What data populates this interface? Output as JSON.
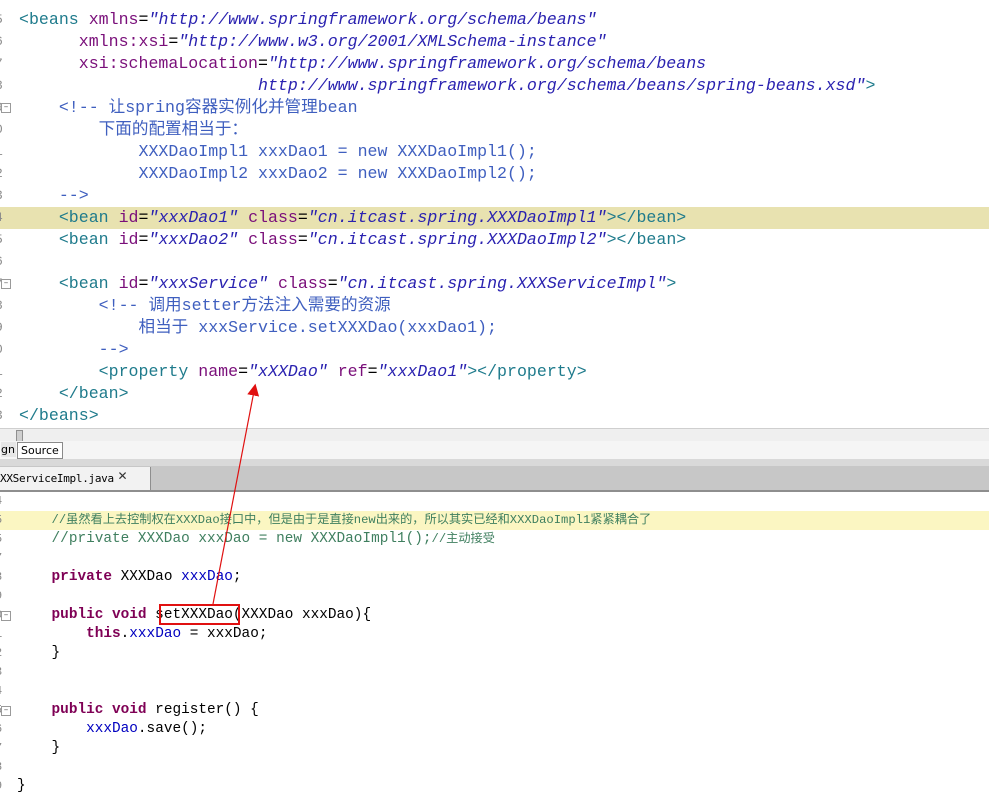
{
  "xml_editor": {
    "line_numbers": [
      "5",
      "6",
      "7",
      "8",
      "9",
      "0",
      "1",
      "2",
      "3",
      "4",
      "5",
      "6",
      "7",
      "8",
      "9",
      "0",
      "1",
      "2",
      "3"
    ],
    "lines": [
      {
        "ind": "",
        "parts": [
          [
            "tag",
            "<beans "
          ],
          [
            "attr",
            "xmlns"
          ],
          [
            "txt",
            "="
          ],
          [
            "val",
            "\"http://www.springframework.org/schema/beans\""
          ]
        ]
      },
      {
        "ind": "      ",
        "parts": [
          [
            "attr",
            "xmlns:xsi"
          ],
          [
            "txt",
            "="
          ],
          [
            "val",
            "\"http://www.w3.org/2001/XMLSchema-instance\""
          ]
        ]
      },
      {
        "ind": "      ",
        "parts": [
          [
            "attr",
            "xsi:schemaLocation"
          ],
          [
            "txt",
            "="
          ],
          [
            "val",
            "\"http://www.springframework.org/schema/beans"
          ]
        ]
      },
      {
        "ind": "                        ",
        "parts": [
          [
            "val",
            "http://www.springframework.org/schema/beans/spring-beans.xsd\""
          ],
          [
            "tag",
            ">"
          ]
        ]
      },
      {
        "ind": "    ",
        "parts": [
          [
            "cmt",
            "<!-- 让spring容器实例化并管理bean"
          ]
        ]
      },
      {
        "ind": "        ",
        "parts": [
          [
            "cmt",
            "下面的配置相当于："
          ]
        ]
      },
      {
        "ind": "            ",
        "parts": [
          [
            "cmt",
            "XXXDaoImpl1 xxxDao1 = new XXXDaoImpl1();"
          ]
        ]
      },
      {
        "ind": "            ",
        "parts": [
          [
            "cmt",
            "XXXDaoImpl2 xxxDao2 = new XXXDaoImpl2();"
          ]
        ]
      },
      {
        "ind": "    ",
        "parts": [
          [
            "cmt",
            "-->"
          ]
        ]
      },
      {
        "ind": "    ",
        "parts": [
          [
            "tag",
            "<bean "
          ],
          [
            "attr",
            "id"
          ],
          [
            "txt",
            "="
          ],
          [
            "val",
            "\"xxxDao1\""
          ],
          [
            "txt",
            " "
          ],
          [
            "attr",
            "class"
          ],
          [
            "txt",
            "="
          ],
          [
            "val",
            "\"cn.itcast.spring.XXXDaoImpl1\""
          ],
          [
            "tag",
            "></bean>"
          ]
        ]
      },
      {
        "ind": "    ",
        "parts": [
          [
            "tag",
            "<bean "
          ],
          [
            "attr",
            "id"
          ],
          [
            "txt",
            "="
          ],
          [
            "val",
            "\"xxxDao2\""
          ],
          [
            "txt",
            " "
          ],
          [
            "attr",
            "class"
          ],
          [
            "txt",
            "="
          ],
          [
            "val",
            "\"cn.itcast.spring.XXXDaoImpl2\""
          ],
          [
            "tag",
            "></bean>"
          ]
        ]
      },
      {
        "ind": "",
        "parts": []
      },
      {
        "ind": "    ",
        "parts": [
          [
            "tag",
            "<bean "
          ],
          [
            "attr",
            "id"
          ],
          [
            "txt",
            "="
          ],
          [
            "val",
            "\"xxxService\""
          ],
          [
            "txt",
            " "
          ],
          [
            "attr",
            "class"
          ],
          [
            "txt",
            "="
          ],
          [
            "val",
            "\"cn.itcast.spring.XXXServiceImpl\""
          ],
          [
            "tag",
            ">"
          ]
        ]
      },
      {
        "ind": "        ",
        "parts": [
          [
            "cmt",
            "<!-- 调用setter方法注入需要的资源"
          ]
        ]
      },
      {
        "ind": "            ",
        "parts": [
          [
            "cmt",
            "相当于 xxxService.setXXXDao(xxxDao1);"
          ]
        ]
      },
      {
        "ind": "        ",
        "parts": [
          [
            "cmt",
            "-->"
          ]
        ]
      },
      {
        "ind": "        ",
        "parts": [
          [
            "tag",
            "<property "
          ],
          [
            "attr",
            "name"
          ],
          [
            "txt",
            "="
          ],
          [
            "val",
            "\"xXXDao\""
          ],
          [
            "txt",
            " "
          ],
          [
            "attr",
            "ref"
          ],
          [
            "txt",
            "="
          ],
          [
            "val",
            "\"xxxDao1\""
          ],
          [
            "tag",
            "></property>"
          ]
        ]
      },
      {
        "ind": "    ",
        "parts": [
          [
            "tag",
            "</bean>"
          ]
        ]
      },
      {
        "ind": "",
        "parts": [
          [
            "tag",
            "</beans>"
          ]
        ]
      }
    ],
    "highlighted_line": 9
  },
  "mode_tabs": {
    "design_label": "gn",
    "source_label": "Source"
  },
  "java_tab": {
    "filename": "XXServiceImpl.java",
    "close_glyph": "✕"
  },
  "java_editor": {
    "line_numbers": [
      "4",
      "5",
      "5",
      "7",
      "8",
      "9",
      "0",
      "1",
      "2",
      "3",
      "4",
      "5",
      "6",
      "7",
      "8",
      "9"
    ],
    "lines": [
      {
        "ind": "",
        "parts": []
      },
      {
        "ind": "    ",
        "parts": [
          [
            "jcmt small",
            "//虽然看上去控制权在XXXDao接口中，但是由于是直接new出来的，所以其实已经和XXXDaoImpl1紧紧耦合了"
          ]
        ]
      },
      {
        "ind": "    ",
        "parts": [
          [
            "jcmt",
            "//private XXXDao xxxDao = new XXXDaoImpl1();"
          ],
          [
            "jcmt small",
            "//主动接受"
          ]
        ]
      },
      {
        "ind": "",
        "parts": []
      },
      {
        "ind": "    ",
        "parts": [
          [
            "kw",
            "private"
          ],
          [
            "ptxt",
            " XXXDao "
          ],
          [
            "fld",
            "xxxDao"
          ],
          [
            "ptxt",
            ";"
          ]
        ]
      },
      {
        "ind": "",
        "parts": []
      },
      {
        "ind": "    ",
        "parts": [
          [
            "kw",
            "public void"
          ],
          [
            "ptxt",
            " setXXXDao(XXXDao xxxDao){"
          ]
        ]
      },
      {
        "ind": "        ",
        "parts": [
          [
            "kw",
            "this"
          ],
          [
            "ptxt",
            "."
          ],
          [
            "fld",
            "xxxDao"
          ],
          [
            "ptxt",
            " = xxxDao;"
          ]
        ]
      },
      {
        "ind": "    ",
        "parts": [
          [
            "ptxt",
            "}"
          ]
        ]
      },
      {
        "ind": "",
        "parts": []
      },
      {
        "ind": "",
        "parts": []
      },
      {
        "ind": "    ",
        "parts": [
          [
            "kw",
            "public void"
          ],
          [
            "ptxt",
            " register() {"
          ]
        ]
      },
      {
        "ind": "        ",
        "parts": [
          [
            "fld",
            "xxxDao"
          ],
          [
            "ptxt",
            ".save();"
          ]
        ]
      },
      {
        "ind": "    ",
        "parts": [
          [
            "ptxt",
            "}"
          ]
        ]
      },
      {
        "ind": "",
        "parts": []
      },
      {
        "ind": "",
        "parts": [
          [
            "ptxt",
            "}"
          ]
        ]
      }
    ],
    "highlighted_line": 1
  },
  "colors": {
    "red_annotation": "#e01010",
    "highlight_xml": "#e8e2b0",
    "highlight_java": "#fbf6c2"
  }
}
